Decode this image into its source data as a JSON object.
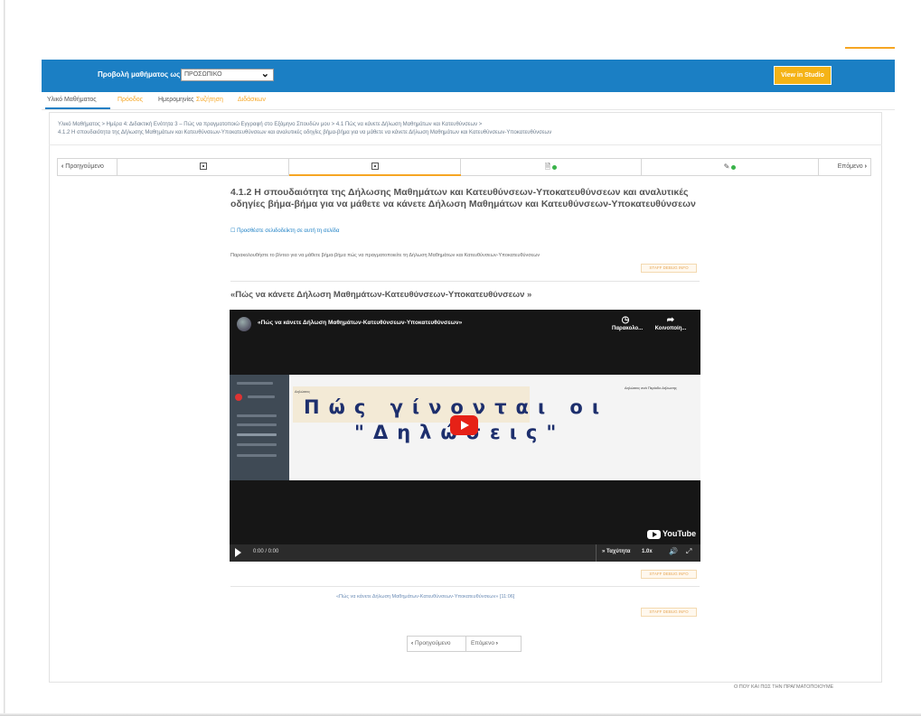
{
  "header": {
    "view_as_label": "Προβολή μαθήματος ως:",
    "view_as_value": "ΠΡΟΣΩΠΙΚΟ",
    "studio_button": "View in Studio",
    "accent_color": "#1b7fc4",
    "highlight_color": "#f6a623"
  },
  "course_nav": {
    "tabs": [
      "Υλικό Μαθήματος",
      "Πρόοδος",
      "Ημερομηνίες",
      "Συζήτηση",
      "Διδάσκων"
    ],
    "active_tab": "Υλικό Μαθήματος"
  },
  "breadcrumb": {
    "line1": "Υλικό Μαθήματος  >  Ημέρα 4: Διδακτική Ενότητα 3 – Πώς να πραγματοποιώ Εγγραφή στο Εξάμηνο Σπουδών μου  >  4.1 Πώς να κάνετε Δήλωση Μαθημάτων και Κατευθύνσεων  >",
    "line2": "4.1.2 Η σπουδαιότητα της Δήλωσης Μαθημάτων και Κατευθύνσεων-Υποκατευθύνσεων και αναλυτικές οδηγίες βήμα-βήμα για να μάθετε να κάνετε Δήλωση Μαθημάτων και Κατευθύνσεων-Υποκατευθύνσεων"
  },
  "sequence": {
    "prev_label": "Προηγούμενο",
    "next_label": "Επόμενο",
    "active_index": 1
  },
  "unit": {
    "title": "4.1.2 Η σπουδαιότητα της Δήλωσης Μαθημάτων και Κατευθύνσεων-Υποκατευθύνσεων και αναλυτικές οδηγίες βήμα-βήμα για να μάθετε να κάνετε Δήλωση Μαθημάτων και Κατευθύνσεων-Υποκατευθύνσεων",
    "bookmark": "Προσθέστε σελιδοδείκτη σε αυτή τη σελίδα",
    "intro": "Παρακολουθήστε το βίντεο για να μάθετε βήμα-βήμα πώς να πραγματοποιείτε τη Δήλωση Μαθημάτων και Κατευθύνσεων-Υποκατευθύνσεων",
    "staff_debug": "STAFF DEBUG INFO",
    "video_heading": "«Πώς να κάνετε Δήλωση Μαθημάτων-Κατευθύνσεων-Υποκατευθύνσεων »",
    "transcript_link": "«Πώς να κάνετε Δήλωση Μαθημάτων-Κατευθύνσεων-Υποκατευθύνσεων» [11:06]"
  },
  "video": {
    "title": "«Πώς να κάνετε Δήλωση Μαθημάτων-Κατευθύνσεων-Υποκατευθύνσεων»",
    "watch_later": "Παρακολο...",
    "share": "Κοινοποίη...",
    "overlay_line1": "Πώς γίνονται οι",
    "overlay_line2": "\"Δηλώσεις\"",
    "screen_header": "Δηλώσεις",
    "screen_right": "Δηλώσεις ανά Περίοδο Δήλωσης",
    "youtube_label": "YouTube",
    "time": "0:00 / 0:00",
    "speed_label": "» Ταχύτητα",
    "speed_value": "1.0x"
  },
  "bottom_nav": {
    "prev": "Προηγούμενο",
    "next": "Επόμενο"
  },
  "footer": {
    "text": "Ο ΠΟΥ ΚΑΙ ΠΩΣ ΤΗΝ ΠΡΑΓΜΑΤΟΠΟΙΟΥΜΕ"
  }
}
